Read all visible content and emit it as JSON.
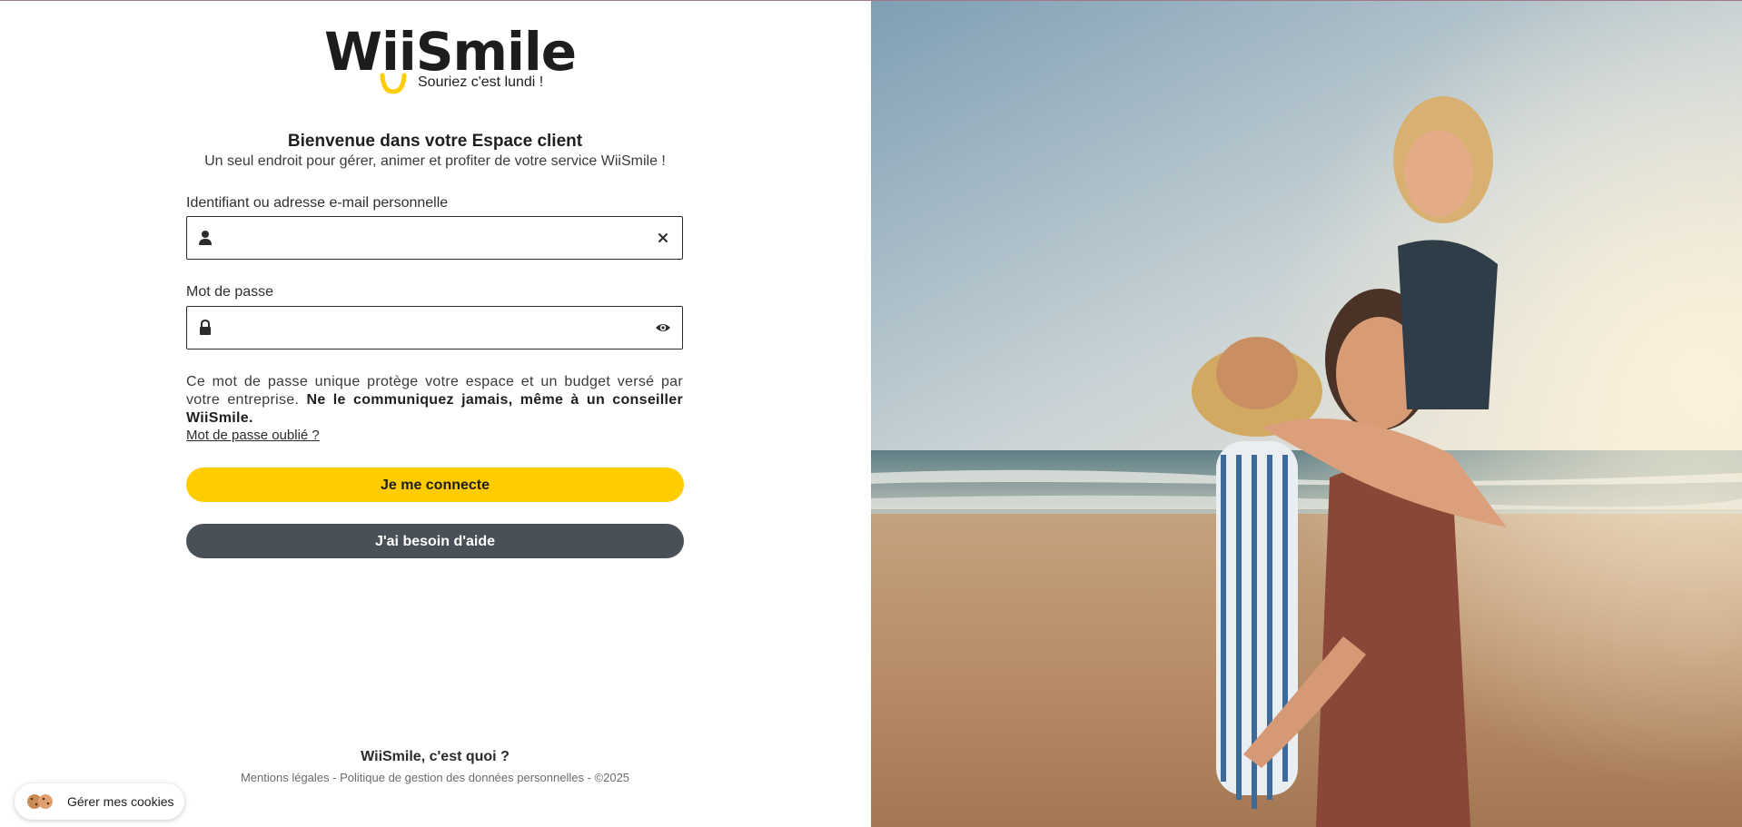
{
  "brand": {
    "name_prefix": "W",
    "name_dots": "ii",
    "name_suffix": "Smile",
    "tagline": "Souriez c'est lundi !",
    "accent_color": "#ffcc00",
    "dark_color": "#4a5057"
  },
  "welcome": {
    "title": "Bienvenue dans votre Espace client",
    "subtitle": "Un seul endroit pour gérer, animer et profiter de votre service WiiSmile !"
  },
  "login": {
    "identifier_label": "Identifiant ou adresse e-mail personnelle",
    "identifier_value": "",
    "identifier_icon": "user-icon",
    "clear_icon": "close-icon",
    "password_label": "Mot de passe",
    "password_value": "",
    "password_icon": "lock-icon",
    "reveal_icon": "eye-icon"
  },
  "notice": {
    "text": "Ce mot de passe unique protège votre espace et un budget versé par votre entreprise. ",
    "bold": "Ne le communiquez jamais, même à un conseiller WiiSmile.",
    "forgot_link": "Mot de passe oublié ?"
  },
  "buttons": {
    "connect": "Je me connecte",
    "help": "J'ai besoin d'aide"
  },
  "footer": {
    "about_link": "WiiSmile, c'est quoi ?",
    "legal": "Mentions légales",
    "separator": " - ",
    "privacy": "Politique de gestion des données personnelles",
    "copyright": "©2025"
  },
  "cookies": {
    "label": "Gérer mes cookies",
    "icon": "cookie-icon"
  }
}
